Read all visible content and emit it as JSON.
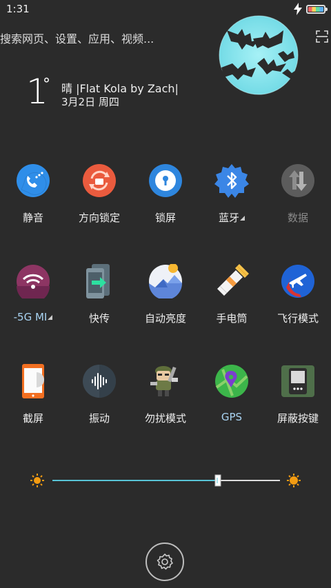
{
  "status": {
    "time": "1:31",
    "battery_level": 1.0
  },
  "search": {
    "text": "搜索网页、设置、应用、视频..."
  },
  "weather": {
    "temperature": "1",
    "degree_symbol": "°",
    "condition_line": "晴  |Flat Kola by Zach|",
    "date": "3月2日 周四"
  },
  "tiles": [
    {
      "label": "静音",
      "icon": "phone-vibrate-icon"
    },
    {
      "label": "方向锁定",
      "icon": "rotation-lock-icon"
    },
    {
      "label": "锁屏",
      "icon": "lock-screen-icon"
    },
    {
      "label": "蓝牙",
      "icon": "bluetooth-icon"
    },
    {
      "label": "数据",
      "icon": "mobile-data-icon"
    },
    {
      "label": "-5G     MI",
      "icon": "wifi-icon"
    },
    {
      "label": "快传",
      "icon": "quick-transfer-icon"
    },
    {
      "label": "自动亮度",
      "icon": "auto-brightness-icon"
    },
    {
      "label": "手电筒",
      "icon": "flashlight-icon"
    },
    {
      "label": "飞行模式",
      "icon": "airplane-mode-icon"
    },
    {
      "label": "截屏",
      "icon": "screenshot-icon"
    },
    {
      "label": "振动",
      "icon": "vibration-icon"
    },
    {
      "label": "勿扰模式",
      "icon": "do-not-disturb-icon"
    },
    {
      "label": "GPS",
      "icon": "gps-icon"
    },
    {
      "label": "屏蔽按键",
      "icon": "block-keys-icon"
    }
  ],
  "brightness": {
    "level": 0.73
  },
  "colors": {
    "background": "#2b2b2b",
    "accent": "#58c5d7",
    "moon": "#8fe6ee"
  }
}
